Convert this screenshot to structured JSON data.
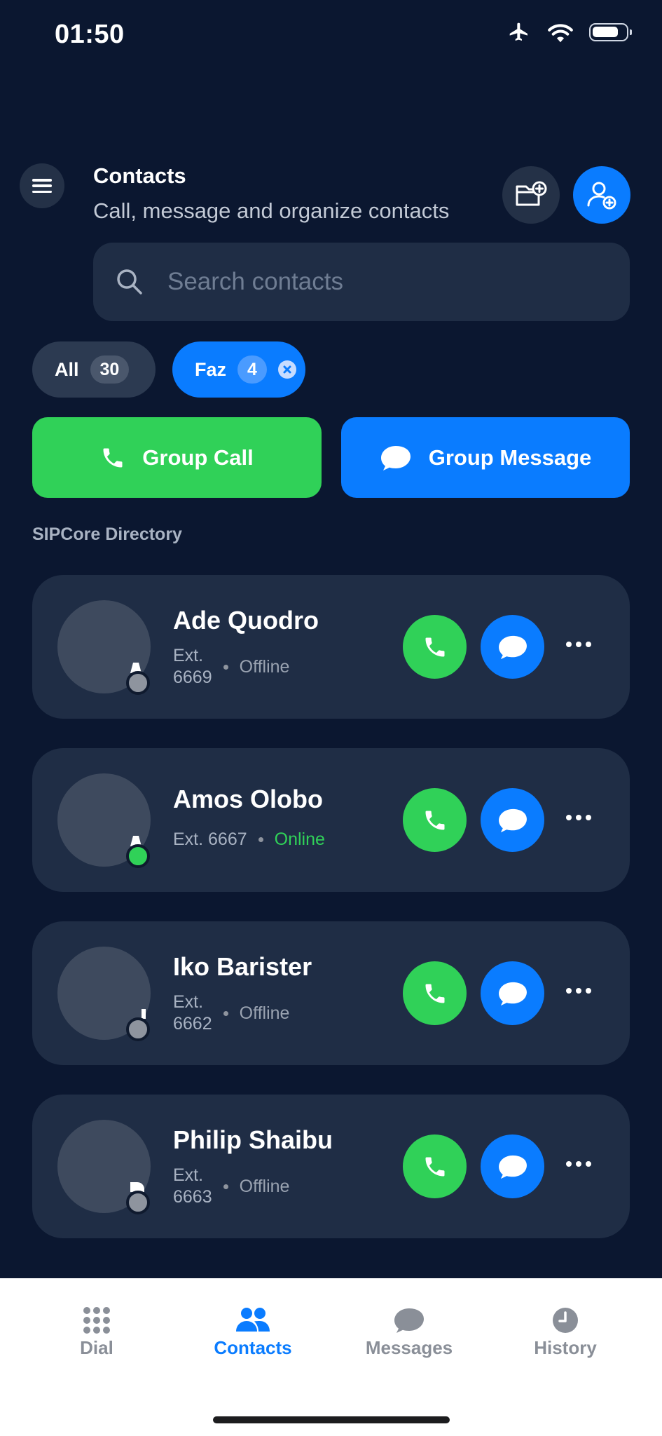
{
  "status_bar": {
    "time": "01:50"
  },
  "header": {
    "title": "Contacts",
    "subtitle": "Call, message and organize contacts"
  },
  "search": {
    "placeholder": "Search contacts"
  },
  "filters": [
    {
      "label": "All",
      "count": "30"
    },
    {
      "label": "Faz",
      "count": "4"
    }
  ],
  "actions": {
    "group_call": "Group Call",
    "group_message": "Group Message"
  },
  "section_label": "SIPCore Directory",
  "contacts": [
    {
      "name": "Ade Quodro",
      "ext_label": "Ext.",
      "ext_number": "6669",
      "status": "Offline"
    },
    {
      "name": "Amos Olobo",
      "ext_label": "Ext. 6667",
      "status": "Online"
    },
    {
      "name": "Iko Barister",
      "ext_label": "Ext.",
      "ext_number": "6662",
      "status": "Offline"
    },
    {
      "name": "Philip Shaibu",
      "ext_label": "Ext.",
      "ext_number": "6663",
      "status": "Offline"
    }
  ],
  "tabs": [
    {
      "label": "Dial"
    },
    {
      "label": "Contacts"
    },
    {
      "label": "Messages"
    },
    {
      "label": "History"
    }
  ],
  "colors": {
    "background": "#0b1730",
    "card": "#1f2d45",
    "accent_blue": "#0a7cff",
    "accent_green": "#30d158"
  }
}
